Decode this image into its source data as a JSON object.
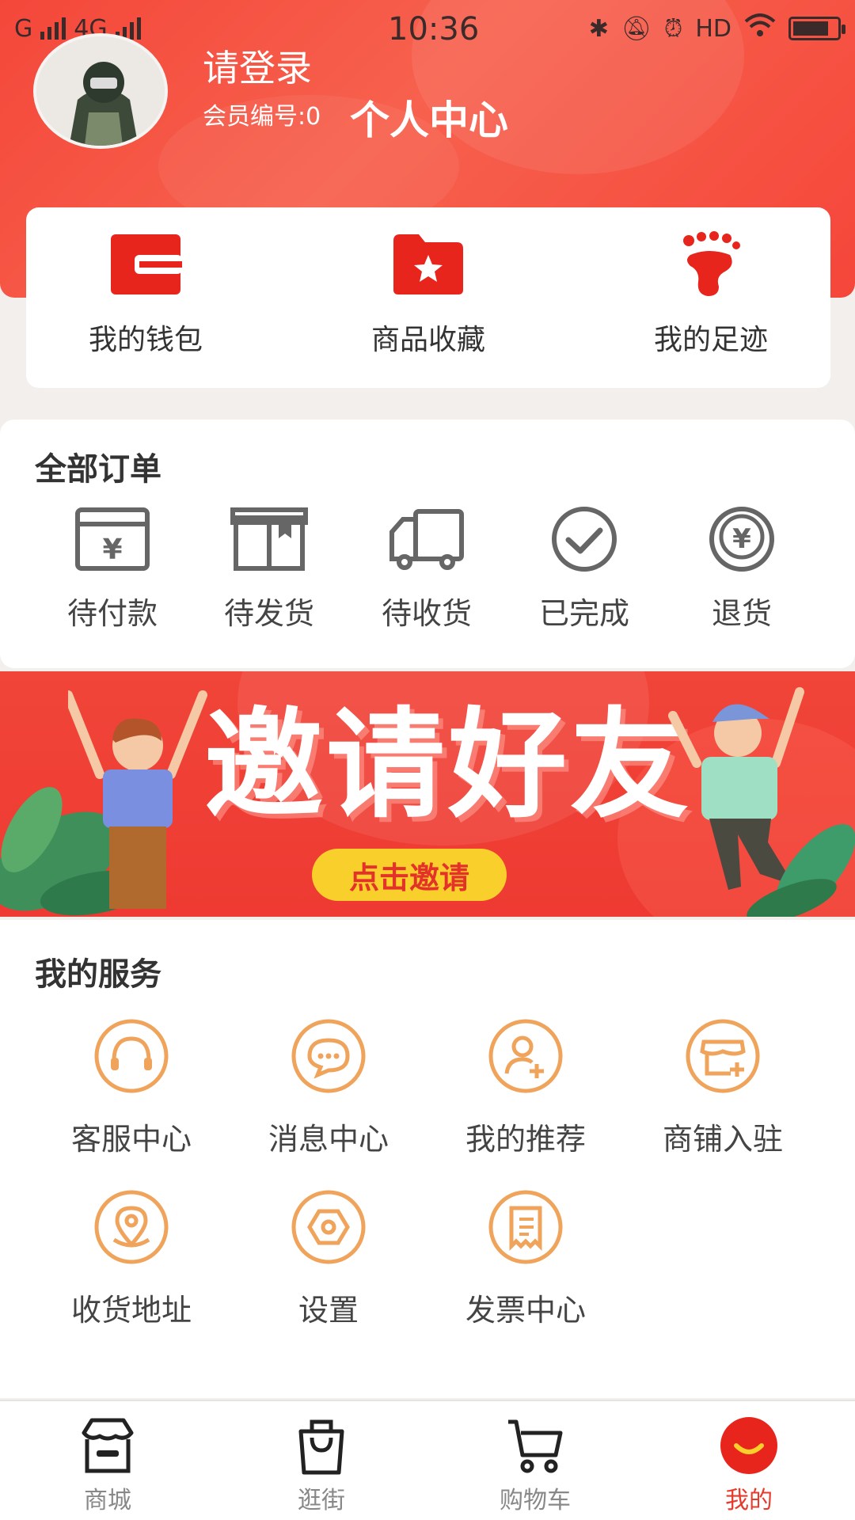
{
  "status_bar": {
    "carrier_left": "G",
    "network": "4G",
    "time": "10:36",
    "hd": "HD"
  },
  "profile": {
    "login_prompt": "请登录",
    "member_label": "会员编号:0",
    "page_title": "个人中心"
  },
  "quick_links": [
    {
      "label": "我的钱包",
      "icon": "wallet-icon"
    },
    {
      "label": "商品收藏",
      "icon": "favorite-folder-icon"
    },
    {
      "label": "我的足迹",
      "icon": "footprint-icon"
    }
  ],
  "orders": {
    "title": "全部订单",
    "items": [
      {
        "label": "待付款",
        "icon": "pending-payment-icon"
      },
      {
        "label": "待发货",
        "icon": "pending-shipment-icon"
      },
      {
        "label": "待收货",
        "icon": "delivery-truck-icon"
      },
      {
        "label": "已完成",
        "icon": "completed-check-icon"
      },
      {
        "label": "退货",
        "icon": "refund-icon"
      }
    ]
  },
  "banner": {
    "title": "邀请好友",
    "button": "点击邀请"
  },
  "services": {
    "title": "我的服务",
    "items": [
      {
        "label": "客服中心",
        "icon": "headset-icon"
      },
      {
        "label": "消息中心",
        "icon": "message-icon"
      },
      {
        "label": "我的推荐",
        "icon": "recommend-user-icon"
      },
      {
        "label": "商铺入驻",
        "icon": "shop-join-icon"
      },
      {
        "label": "收货地址",
        "icon": "location-pin-icon"
      },
      {
        "label": "设置",
        "icon": "settings-icon"
      },
      {
        "label": "发票中心",
        "icon": "invoice-icon"
      }
    ]
  },
  "tabbar": [
    {
      "label": "商城",
      "icon": "store-icon"
    },
    {
      "label": "逛街",
      "icon": "shopping-bag-icon"
    },
    {
      "label": "购物车",
      "icon": "cart-icon"
    },
    {
      "label": "我的",
      "icon": "profile-smile-icon",
      "active": true
    }
  ],
  "colors": {
    "brand_red": "#e83a2c",
    "service_orange": "#f0a35a",
    "banner_button": "#f9cf2b"
  }
}
